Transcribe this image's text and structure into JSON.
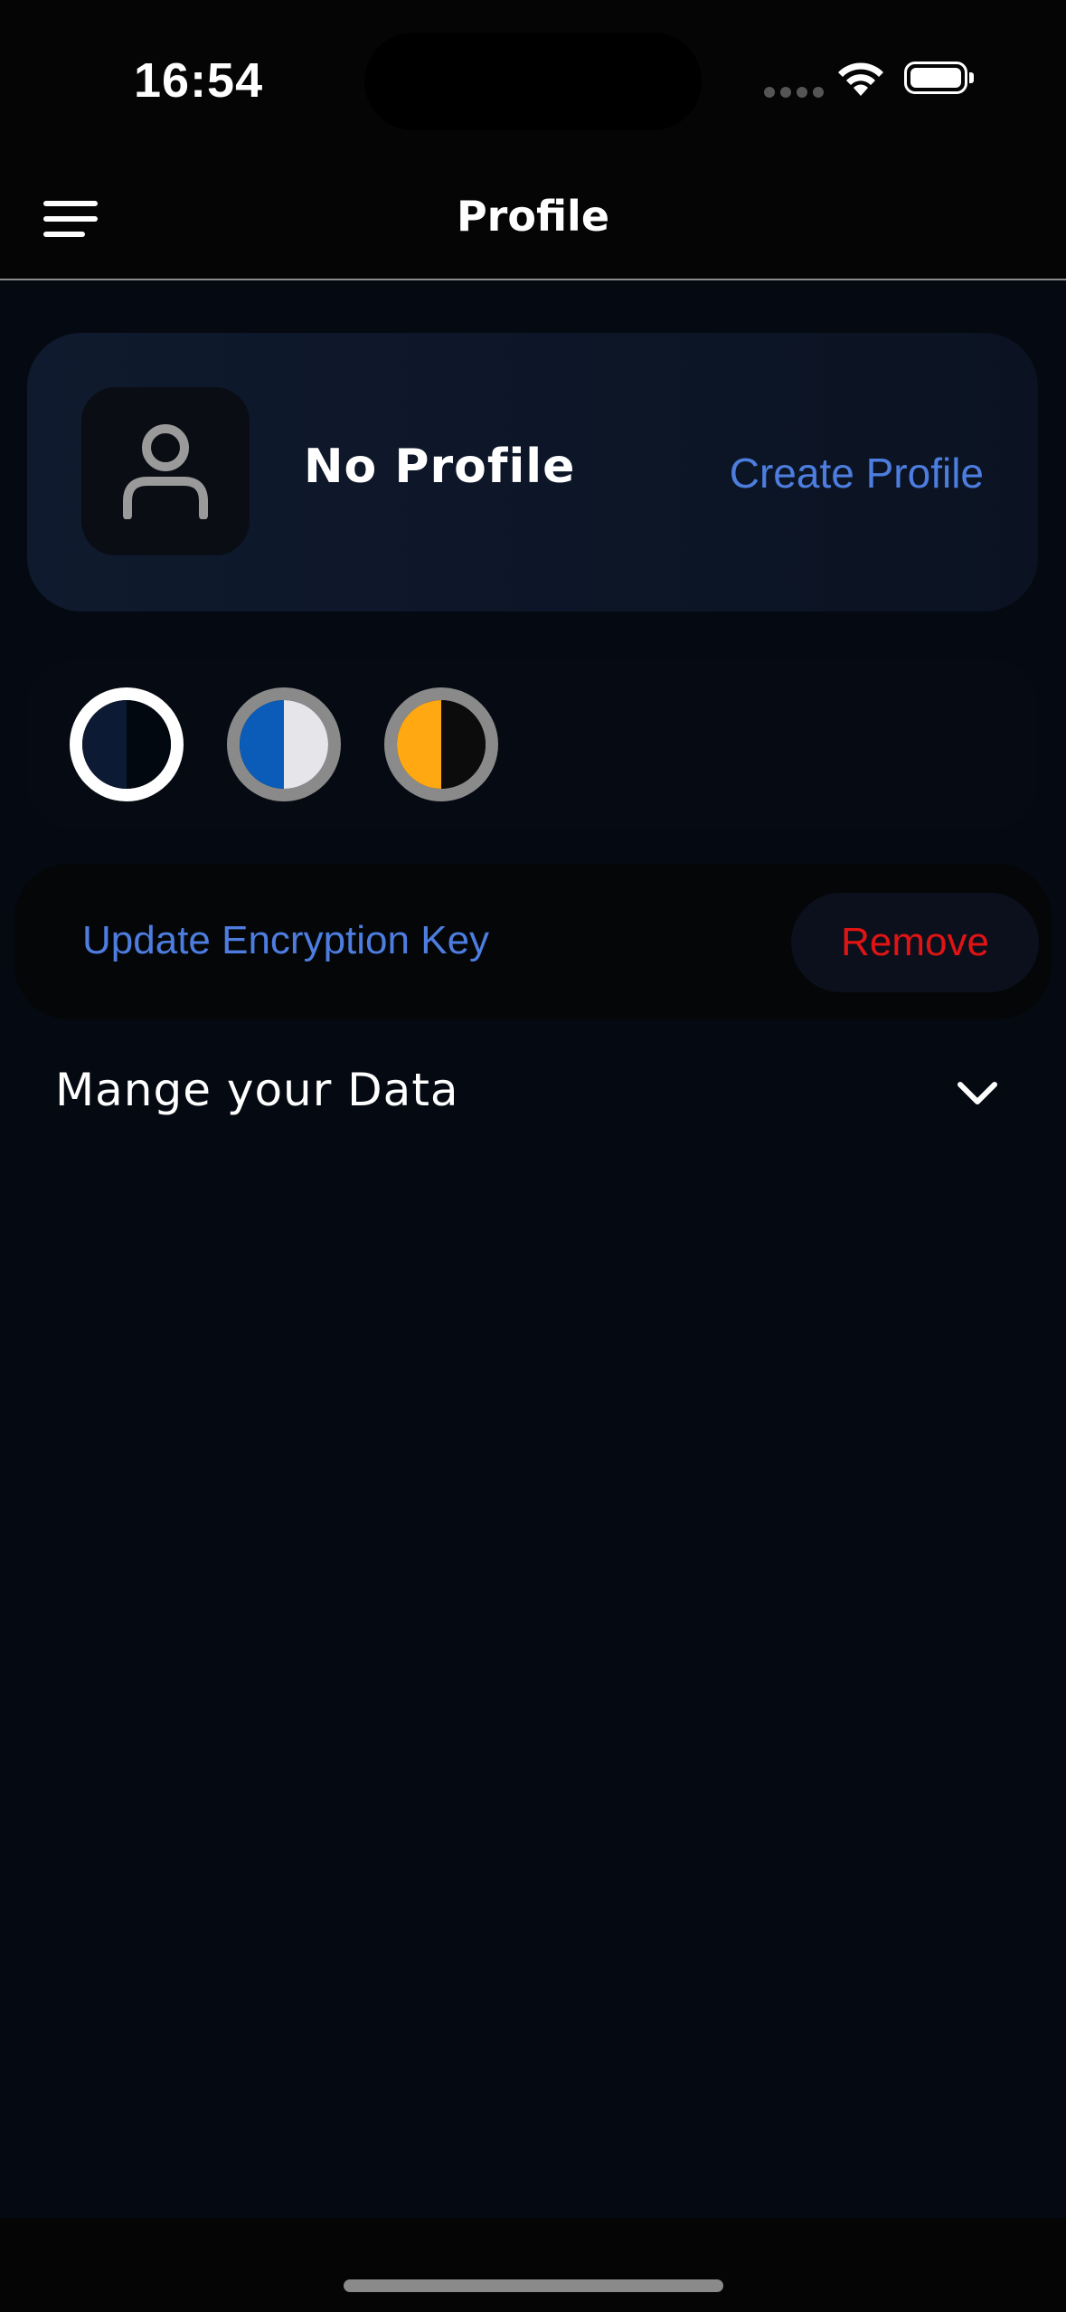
{
  "status_bar": {
    "time": "16:54",
    "icons": [
      "signal-icon",
      "wifi-icon",
      "battery-icon"
    ]
  },
  "nav": {
    "title": "Profile",
    "menu_icon": "hamburger-menu-icon"
  },
  "profile_card": {
    "avatar_icon": "user-icon",
    "name": "No Profile",
    "action_label": "Create Profile"
  },
  "themes": [
    {
      "left": "#0d1a33",
      "right": "#020810",
      "selected": true
    },
    {
      "left": "#0a5cb8",
      "right": "#e6e6ea",
      "selected": false
    },
    {
      "left": "#ffa812",
      "right": "#0c0c0c",
      "selected": false
    }
  ],
  "encryption": {
    "update_label": "Update Encryption Key",
    "remove_label": "Remove"
  },
  "manage": {
    "label": "Mange your Data",
    "icon": "chevron-down-icon"
  },
  "colors": {
    "background": "#050a12",
    "accent": "#4d7ddf",
    "danger": "#e01414"
  }
}
